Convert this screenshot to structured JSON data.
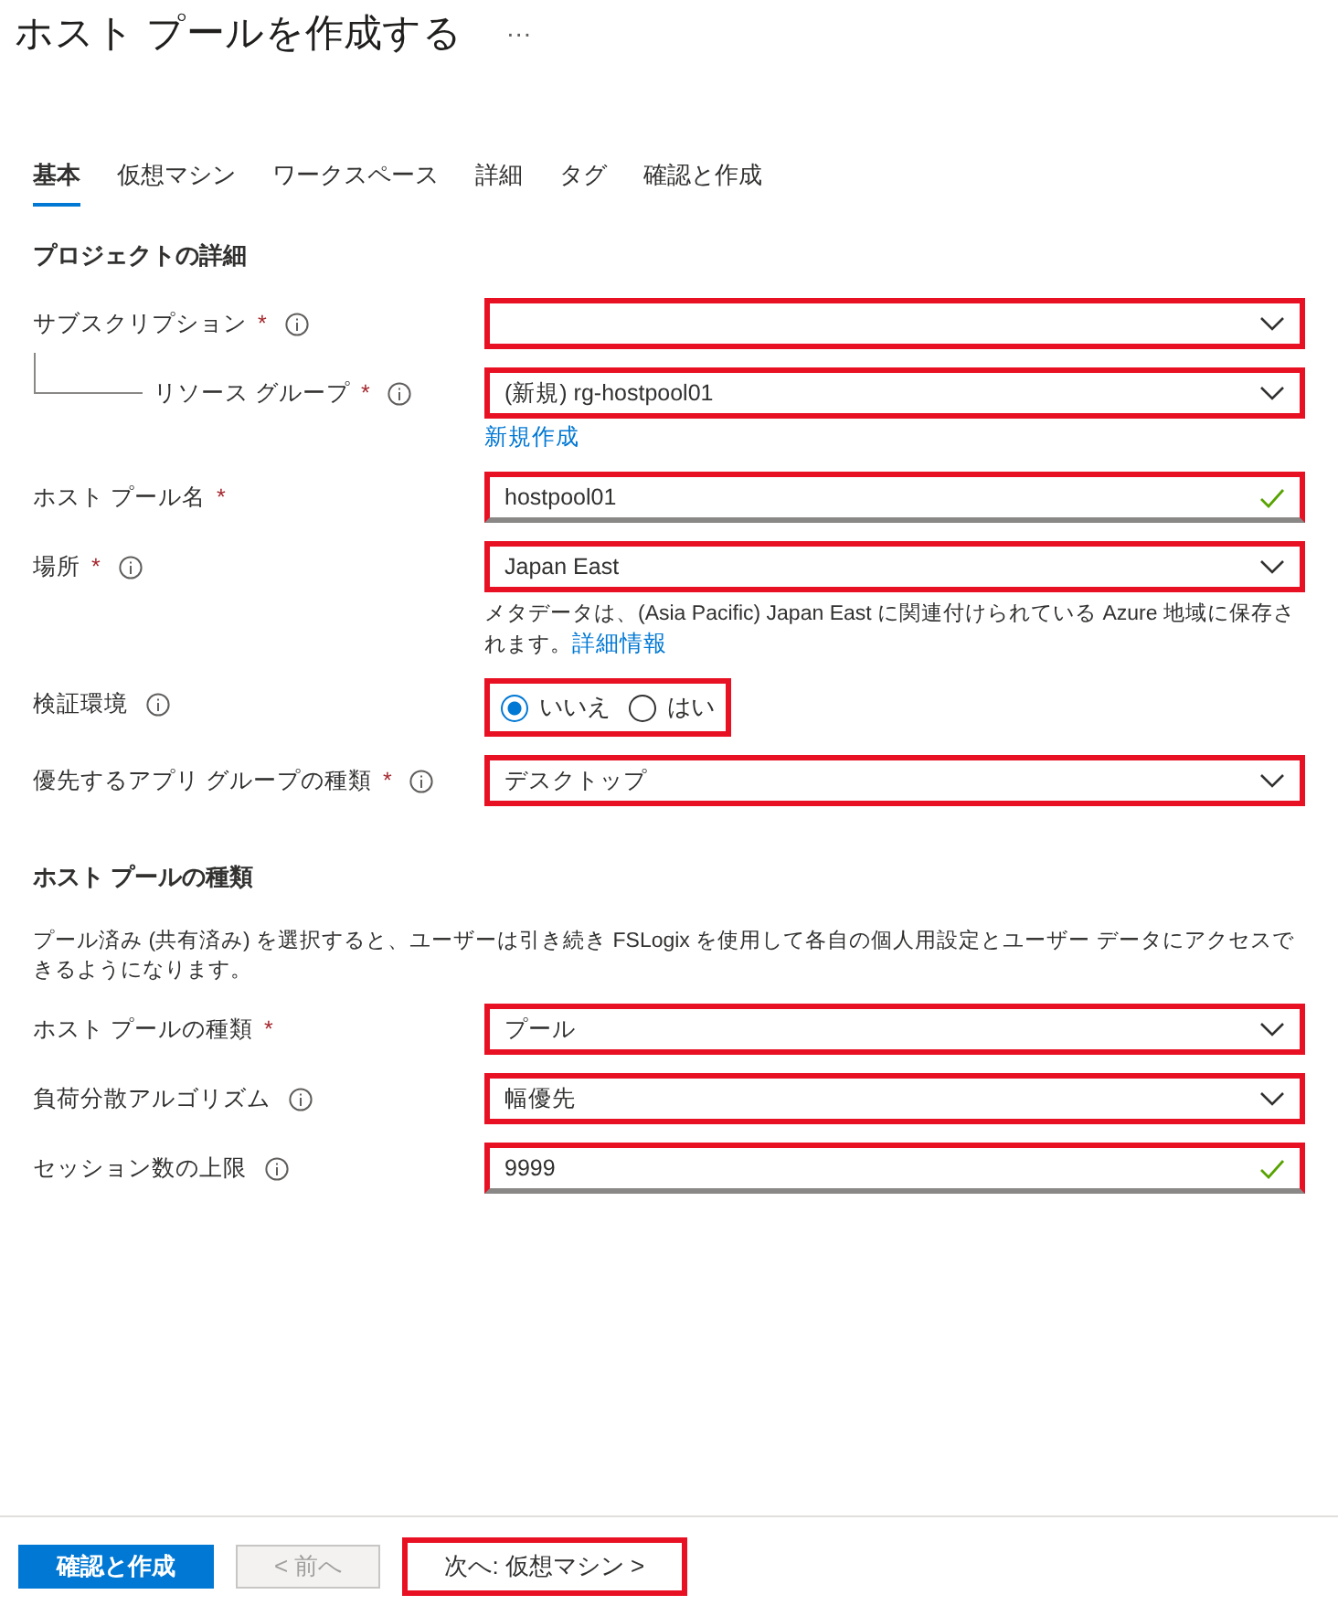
{
  "title": "ホスト プールを作成する",
  "more": "···",
  "tabs": [
    {
      "label": "基本",
      "selected": true
    },
    {
      "label": "仮想マシン",
      "selected": false
    },
    {
      "label": "ワークスペース",
      "selected": false
    },
    {
      "label": "詳細",
      "selected": false
    },
    {
      "label": "タグ",
      "selected": false
    },
    {
      "label": "確認と作成",
      "selected": false
    }
  ],
  "sections": [
    {
      "heading": "プロジェクトの詳細",
      "fields": [
        {
          "kind": "select",
          "label": "サブスクリプション",
          "required_mark": "*",
          "info": true,
          "highlighted": true,
          "children": [
            {
              "kind": "select",
              "label": "リソース グループ",
              "required_mark": "*",
              "info": true,
              "value": "(新規) rg-hostpool01",
              "highlighted": true,
              "link": "新規作成"
            }
          ]
        },
        {
          "kind": "text",
          "label": "ホスト プール名",
          "required_mark": "*",
          "info": false,
          "value": "hostpool01",
          "valid": true,
          "highlighted": true
        },
        {
          "kind": "select",
          "label": "場所",
          "required_mark": "*",
          "info": true,
          "value": "Japan East",
          "highlighted": true,
          "help": "メタデータは、(Asia Pacific) Japan East に関連付けられている Azure 地域に保存されます。",
          "help_link": "詳細情報"
        },
        {
          "kind": "radio",
          "label": "検証環境",
          "info": true,
          "highlighted": true,
          "options": [
            {
              "label": "いいえ",
              "selected": true
            },
            {
              "label": "はい",
              "selected": false
            }
          ]
        },
        {
          "kind": "select",
          "label": "優先するアプリ グループの種類",
          "required_mark": "*",
          "info": true,
          "value": "デスクトップ",
          "highlighted": true
        }
      ]
    },
    {
      "heading": "ホスト プールの種類",
      "description": "プール済み (共有済み) を選択すると、ユーザーは引き続き FSLogix を使用して各自の個人用設定とユーザー データにアクセスできるようになります。",
      "fields": [
        {
          "kind": "select",
          "label": "ホスト プールの種類",
          "required_mark": "*",
          "info": false,
          "value": "プール",
          "highlighted": true
        },
        {
          "kind": "select",
          "label": "負荷分散アルゴリズム",
          "info": true,
          "value": "幅優先",
          "highlighted": true
        },
        {
          "kind": "text",
          "label": "セッション数の上限",
          "info": true,
          "value": "9999",
          "valid": true,
          "highlighted": true
        }
      ]
    }
  ],
  "buttons": [
    {
      "kind": "primary",
      "label": "確認と作成",
      "disabled": false,
      "highlighted": false
    },
    {
      "kind": "secondary",
      "label": "< 前へ",
      "disabled": true,
      "highlighted": false
    },
    {
      "kind": "secondary",
      "label": "次へ: 仮想マシン >",
      "disabled": false,
      "highlighted": true
    }
  ]
}
